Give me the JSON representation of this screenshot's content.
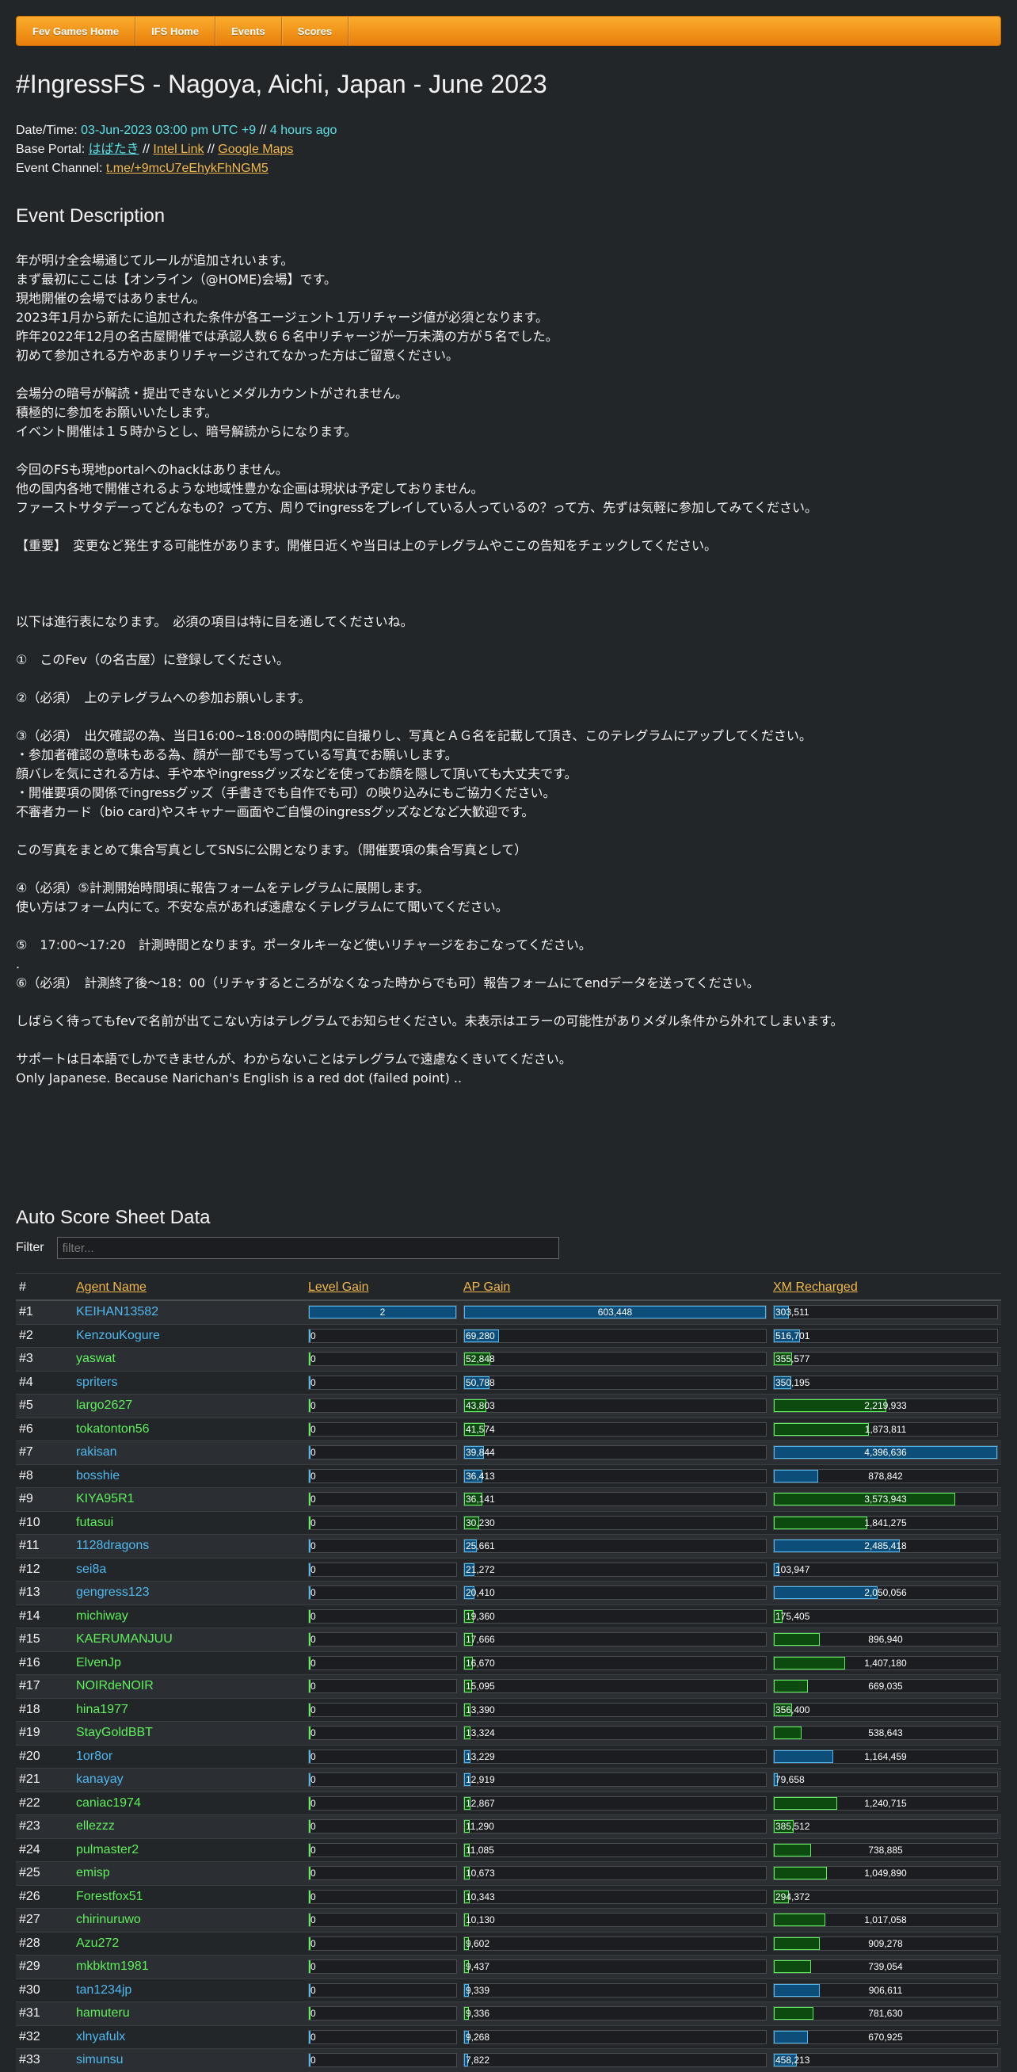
{
  "nav": [
    "Fev Games Home",
    "IFS Home",
    "Events",
    "Scores"
  ],
  "title": "#IngressFS - Nagoya, Aichi, Japan - June 2023",
  "meta": {
    "datetime_label": "Date/Time:",
    "datetime_value": "03-Jun-2023 03:00 pm UTC +9",
    "sep": "//",
    "ago": "4 hours ago",
    "base_label": "Base Portal:",
    "base_portal": "はばたき",
    "intel_link": "Intel Link",
    "maps_link": "Google Maps",
    "channel_label": "Event Channel:",
    "channel": "t.me/+9mcU7eEhykFhNGM5"
  },
  "desc_heading": "Event Description",
  "description": "年が明け全会場通じてルールが追加されいます。\nまず最初にここは【オンライン（@HOME)会場】です。\n現地開催の会場ではありません。\n2023年1月から新たに追加された条件が各エージェント１万リチャージ値が必須となります。\n昨年2022年12月の名古屋開催では承認人数６６名中リチャージが一万未満の方が５名でした。\n初めて参加される方やあまりリチャージされてなかった方はご留意ください。\n\n会場分の暗号が解読・提出できないとメダルカウントがされません。\n積極的に参加をお願いいたします。\nイベント開催は１５時からとし、暗号解読からになります。\n\n今回のFSも現地portalへのhackはありません。\n他の国内各地で開催されるような地域性豊かな企画は現状は予定しておりません。\nファーストサタデーってどんなもの？って方、周りでingressをプレイしている人っているの？って方、先ずは気軽に参加してみてください。\n\n【重要】　変更など発生する可能性があります。開催日近くや当日は上のテレグラムやここの告知をチェックしてください。\n\n\n\n以下は進行表になります。　必須の項目は特に目を通してくださいね。\n\n①　このFev（の名古屋）に登録してください。\n\n②（必須）　上のテレグラムへの参加お願いします。\n\n③（必須）　出欠確認の為、当日16:00~18:00の時間内に自撮りし、写真とＡＧ名を記載して頂き、このテレグラムにアップしてください。\n・参加者確認の意味もある為、顔が一部でも写っている写真でお願いします。\n顔バレを気にされる方は、手や本やingressグッズなどを使ってお顔を隠して頂いても大丈夫です。\n・開催要項の関係でingressグッズ（手書きでも自作でも可）の映り込みにもご協力ください。\n不審者カード（bio card)やスキャナー画面やご自慢のingressグッズなどなど大歓迎です。\n\nこの写真をまとめて集合写真としてSNSに公開となります。（開催要項の集合写真として）\n\n④（必須）⑤計測開始時間頃に報告フォームをテレグラムに展開します。\n使い方はフォーム内にて。不安な点があれば遠慮なくテレグラムにて聞いてください。\n\n⑤　17:00～17:20　計測時間となります。ポータルキーなど使いリチャージをおこなってください。\n.\n⑥（必須）　計測終了後～18：00（リチャするところがなくなった時からでも可）報告フォームにてendデータを送ってください。\n\nしばらく待ってもfevで名前が出てこない方はテレグラムでお知らせください。未表示はエラーの可能性がありメダル条件から外れてしまいます。\n\nサポートは日本語でしかできませんが、わからないことはテレグラムで遠慮なくきいてください。\nOnly Japanese. Because Narichan's English is a red dot (failed point) ..",
  "score_heading": "Auto Score Sheet Data",
  "filter": {
    "label": "Filter",
    "placeholder": "filter..."
  },
  "columns": [
    "#",
    "Agent Name",
    "Level Gain",
    "AP Gain",
    "XM Recharged"
  ],
  "maxes": {
    "level": 2,
    "ap": 603448,
    "xm": 4396636
  },
  "colors": {
    "blue": "#4fb8ef",
    "green": "#5ef05a",
    "nav": "#f39313"
  },
  "rows": [
    {
      "rank": "#1",
      "agent": "KEIHAN13582",
      "faction": "blue",
      "level": "2",
      "ap": "603,448",
      "xm": "303,511"
    },
    {
      "rank": "#2",
      "agent": "KenzouKogure",
      "faction": "blue",
      "level": "0",
      "ap": "69,280",
      "xm": "516,701"
    },
    {
      "rank": "#3",
      "agent": "yaswat",
      "faction": "green",
      "level": "0",
      "ap": "52,848",
      "xm": "355,577"
    },
    {
      "rank": "#4",
      "agent": "spriters",
      "faction": "blue",
      "level": "0",
      "ap": "50,788",
      "xm": "350,195"
    },
    {
      "rank": "#5",
      "agent": "largo2627",
      "faction": "green",
      "level": "0",
      "ap": "43,803",
      "xm": "2,219,933"
    },
    {
      "rank": "#6",
      "agent": "tokatonton56",
      "faction": "green",
      "level": "0",
      "ap": "41,574",
      "xm": "1,873,811"
    },
    {
      "rank": "#7",
      "agent": "rakisan",
      "faction": "blue",
      "level": "0",
      "ap": "39,844",
      "xm": "4,396,636"
    },
    {
      "rank": "#8",
      "agent": "bosshie",
      "faction": "blue",
      "level": "0",
      "ap": "36,413",
      "xm": "878,842"
    },
    {
      "rank": "#9",
      "agent": "KIYA95R1",
      "faction": "green",
      "level": "0",
      "ap": "36,141",
      "xm": "3,573,943"
    },
    {
      "rank": "#10",
      "agent": "futasui",
      "faction": "green",
      "level": "0",
      "ap": "30,230",
      "xm": "1,841,275"
    },
    {
      "rank": "#11",
      "agent": "1128dragons",
      "faction": "blue",
      "level": "0",
      "ap": "25,661",
      "xm": "2,485,418"
    },
    {
      "rank": "#12",
      "agent": "sei8a",
      "faction": "blue",
      "level": "0",
      "ap": "21,272",
      "xm": "103,947"
    },
    {
      "rank": "#13",
      "agent": "gengress123",
      "faction": "blue",
      "level": "0",
      "ap": "20,410",
      "xm": "2,050,056"
    },
    {
      "rank": "#14",
      "agent": "michiway",
      "faction": "green",
      "level": "0",
      "ap": "19,360",
      "xm": "175,405"
    },
    {
      "rank": "#15",
      "agent": "KAERUMANJUU",
      "faction": "green",
      "level": "0",
      "ap": "17,666",
      "xm": "896,940"
    },
    {
      "rank": "#16",
      "agent": "ElvenJp",
      "faction": "green",
      "level": "0",
      "ap": "16,670",
      "xm": "1,407,180"
    },
    {
      "rank": "#17",
      "agent": "NOIRdeNOIR",
      "faction": "green",
      "level": "0",
      "ap": "15,095",
      "xm": "669,035"
    },
    {
      "rank": "#18",
      "agent": "hina1977",
      "faction": "green",
      "level": "0",
      "ap": "13,390",
      "xm": "356,400"
    },
    {
      "rank": "#19",
      "agent": "StayGoldBBT",
      "faction": "green",
      "level": "0",
      "ap": "13,324",
      "xm": "538,643"
    },
    {
      "rank": "#20",
      "agent": "1or8or",
      "faction": "blue",
      "level": "0",
      "ap": "13,229",
      "xm": "1,164,459"
    },
    {
      "rank": "#21",
      "agent": "kanayay",
      "faction": "blue",
      "level": "0",
      "ap": "12,919",
      "xm": "79,658"
    },
    {
      "rank": "#22",
      "agent": "caniac1974",
      "faction": "green",
      "level": "0",
      "ap": "12,867",
      "xm": "1,240,715"
    },
    {
      "rank": "#23",
      "agent": "ellezzz",
      "faction": "green",
      "level": "0",
      "ap": "11,290",
      "xm": "385,512"
    },
    {
      "rank": "#24",
      "agent": "pulmaster2",
      "faction": "green",
      "level": "0",
      "ap": "11,085",
      "xm": "738,885"
    },
    {
      "rank": "#25",
      "agent": "emisp",
      "faction": "green",
      "level": "0",
      "ap": "10,673",
      "xm": "1,049,890"
    },
    {
      "rank": "#26",
      "agent": "Forestfox51",
      "faction": "green",
      "level": "0",
      "ap": "10,343",
      "xm": "294,372"
    },
    {
      "rank": "#27",
      "agent": "chirinuruwo",
      "faction": "green",
      "level": "0",
      "ap": "10,130",
      "xm": "1,017,058"
    },
    {
      "rank": "#28",
      "agent": "Azu272",
      "faction": "green",
      "level": "0",
      "ap": "9,602",
      "xm": "909,278"
    },
    {
      "rank": "#29",
      "agent": "mkbktm1981",
      "faction": "green",
      "level": "0",
      "ap": "9,437",
      "xm": "739,054"
    },
    {
      "rank": "#30",
      "agent": "tan1234jp",
      "faction": "blue",
      "level": "0",
      "ap": "9,339",
      "xm": "906,611"
    },
    {
      "rank": "#31",
      "agent": "hamuteru",
      "faction": "green",
      "level": "0",
      "ap": "9,336",
      "xm": "781,630"
    },
    {
      "rank": "#32",
      "agent": "xlnyafulx",
      "faction": "blue",
      "level": "0",
      "ap": "9,268",
      "xm": "670,925"
    },
    {
      "rank": "#33",
      "agent": "simunsu",
      "faction": "blue",
      "level": "0",
      "ap": "7,822",
      "xm": "458,213"
    }
  ]
}
